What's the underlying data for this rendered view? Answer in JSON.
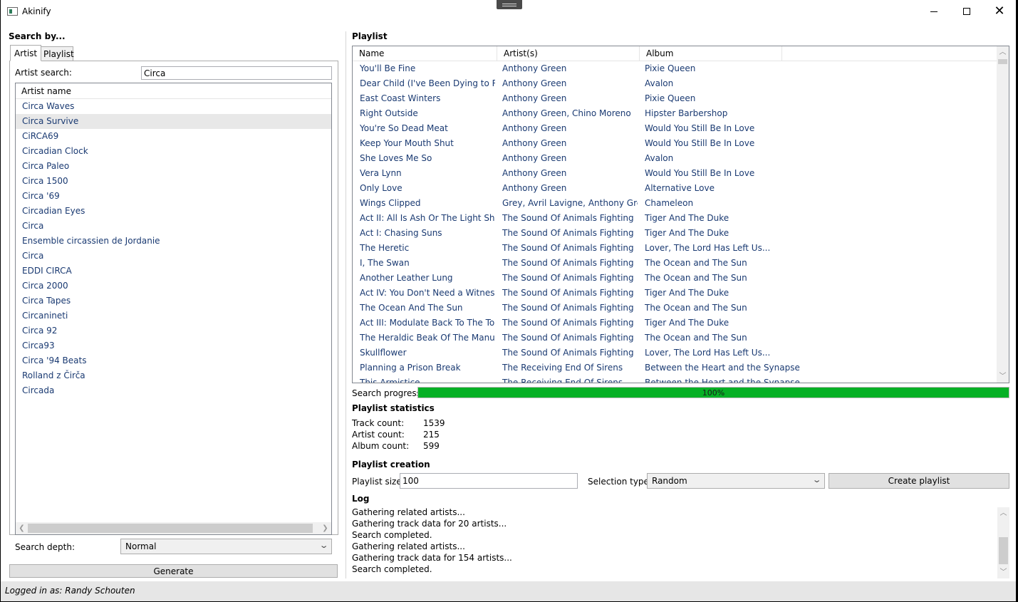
{
  "window": {
    "title": "Akinify"
  },
  "left": {
    "heading": "Search by...",
    "tabs": [
      {
        "label": "Artist"
      },
      {
        "label": "Playlist"
      }
    ],
    "artist_search_label": "Artist search:",
    "artist_search_value": "Circa",
    "artist_list_header": "Artist name",
    "artists": [
      "Circa Waves",
      "Circa Survive",
      "CiRCA69",
      "Circadian Clock",
      "Circa Paleo",
      "Circa 1500",
      "Circa '69",
      "Circadian Eyes",
      "Circa",
      "Ensemble circassien de Jordanie",
      "Circa",
      "EDDI CIRCA",
      "Circa 2000",
      "Circa Tapes",
      "Circanineti",
      "Circa 92",
      "Circa93",
      "Circa '94 Beats",
      "Rolland z Čirča",
      "Circada"
    ],
    "search_depth_label": "Search depth:",
    "search_depth_value": "Normal",
    "generate_label": "Generate"
  },
  "playlist": {
    "heading": "Playlist",
    "columns": [
      "Name",
      "Artist(s)",
      "Album"
    ],
    "rows": [
      [
        "You'll Be Fine",
        "Anthony Green",
        "Pixie Queen"
      ],
      [
        "Dear Child (I've Been Dying to Reach You)",
        "Anthony Green",
        "Avalon"
      ],
      [
        "East Coast Winters",
        "Anthony Green",
        "Pixie Queen"
      ],
      [
        "Right Outside",
        "Anthony Green, Chino Moreno",
        "Hipster Barbershop"
      ],
      [
        "You're So Dead Meat",
        "Anthony Green",
        "Would You Still Be In Love"
      ],
      [
        "Keep Your Mouth Shut",
        "Anthony Green",
        "Would You Still Be In Love"
      ],
      [
        "She Loves Me So",
        "Anthony Green",
        "Avalon"
      ],
      [
        "Vera Lynn",
        "Anthony Green",
        "Would You Still Be In Love"
      ],
      [
        "Only Love",
        "Anthony Green",
        "Alternative Love"
      ],
      [
        "Wings Clipped",
        "Grey, Avril Lavigne, Anthony Green",
        "Chameleon"
      ],
      [
        "Act II: All Is Ash Or The Light Shining",
        "The Sound Of Animals Fighting",
        "Tiger And The Duke"
      ],
      [
        "Act I: Chasing Suns",
        "The Sound Of Animals Fighting",
        "Tiger And The Duke"
      ],
      [
        "The Heretic",
        "The Sound Of Animals Fighting",
        "Lover, The Lord Has Left Us..."
      ],
      [
        "I, The Swan",
        "The Sound Of Animals Fighting",
        "The Ocean and The Sun"
      ],
      [
        "Another Leather Lung",
        "The Sound Of Animals Fighting",
        "The Ocean and The Sun"
      ],
      [
        "Act IV: You Don't Need a Witness",
        "The Sound Of Animals Fighting",
        "Tiger And The Duke"
      ],
      [
        "The Ocean And The Sun",
        "The Sound Of Animals Fighting",
        "The Ocean and The Sun"
      ],
      [
        "Act III: Modulate Back To The Tonic",
        "The Sound Of Animals Fighting",
        "Tiger And The Duke"
      ],
      [
        "The Heraldic Beak Of The Manufacturer",
        "The Sound Of Animals Fighting",
        "The Ocean and The Sun"
      ],
      [
        "Skullflower",
        "The Sound Of Animals Fighting",
        "Lover, The Lord Has Left Us..."
      ],
      [
        "Planning a Prison Break",
        "The Receiving End Of Sirens",
        "Between the Heart and the Synapse"
      ],
      [
        "This Armistice",
        "The Receiving End Of Sirens",
        "Between the Heart and the Synapse"
      ]
    ]
  },
  "search_progress": {
    "label": "Search progress:",
    "percent": 100,
    "text": "100%",
    "color": "#06b025"
  },
  "statistics": {
    "heading": "Playlist statistics",
    "track_label": "Track count:",
    "track_value": "1539",
    "artist_label": "Artist count:",
    "artist_value": "215",
    "album_label": "Album count:",
    "album_value": "599"
  },
  "creation": {
    "heading": "Playlist creation",
    "size_label": "Playlist size:",
    "size_value": "100",
    "selection_label": "Selection type:",
    "selection_value": "Random",
    "create_label": "Create playlist"
  },
  "log": {
    "heading": "Log",
    "lines": [
      "Gathering related artists...",
      "Gathering track data for 20 artists...",
      "Search completed.",
      "Gathering related artists...",
      "Gathering track data for 154 artists...",
      "Search completed."
    ]
  },
  "status": {
    "text": "Logged in as: Randy Schouten"
  }
}
